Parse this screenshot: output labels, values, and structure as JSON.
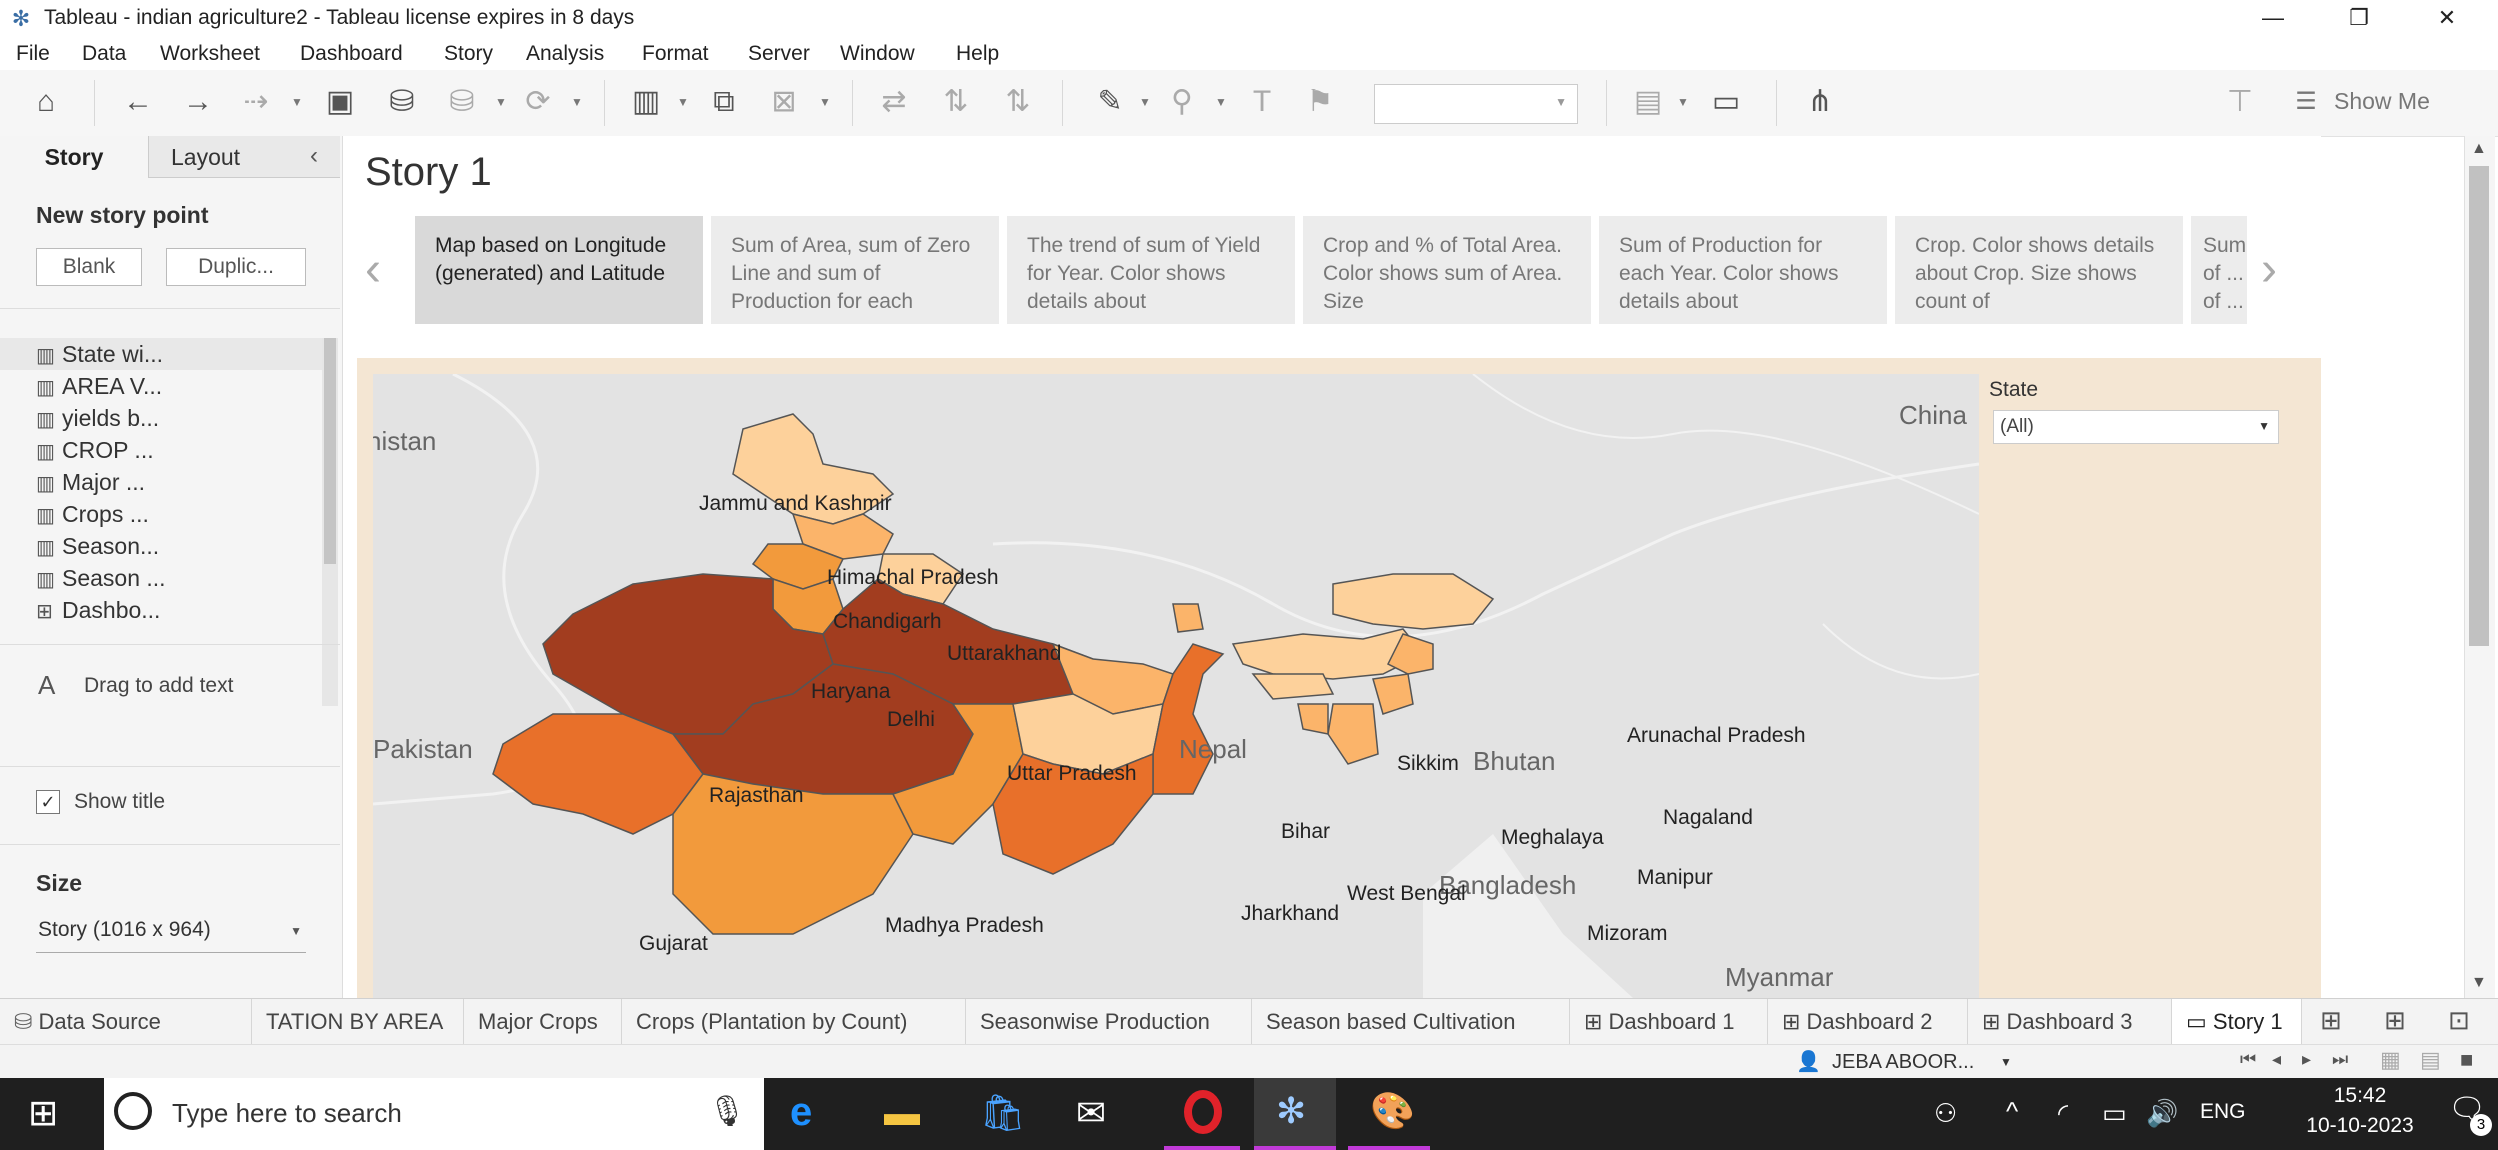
{
  "window": {
    "title": "Tableau - indian agriculture2 - Tableau license expires in 8 days",
    "minimize_icon": "minimize-icon",
    "restore_icon": "restore-icon",
    "close_icon": "close-icon"
  },
  "menu": [
    "File",
    "Data",
    "Worksheet",
    "Dashboard",
    "Story",
    "Analysis",
    "Format",
    "Server",
    "Window",
    "Help"
  ],
  "toolbar": {
    "show_me_label": "Show Me"
  },
  "left_panel": {
    "tabs": [
      "Story",
      "Layout"
    ],
    "new_story_point_heading": "New story point",
    "blank_button": "Blank",
    "duplicate_button": "Duplic...",
    "sheets": [
      {
        "label": "State wi...",
        "icon": "worksheet-icon"
      },
      {
        "label": "AREA V...",
        "icon": "worksheet-icon"
      },
      {
        "label": "yields b...",
        "icon": "worksheet-icon"
      },
      {
        "label": "CROP ...",
        "icon": "worksheet-icon"
      },
      {
        "label": "Major ...",
        "icon": "worksheet-icon"
      },
      {
        "label": "Crops ...",
        "icon": "worksheet-icon"
      },
      {
        "label": "Season...",
        "icon": "worksheet-icon"
      },
      {
        "label": "Season ...",
        "icon": "worksheet-icon"
      },
      {
        "label": "Dashbo...",
        "icon": "dashboard-icon"
      }
    ],
    "drag_text": "Drag to add text",
    "show_title_label": "Show title",
    "show_title_checked": true,
    "size_heading": "Size",
    "size_value": "Story (1016 x 964)"
  },
  "story": {
    "title": "Story 1",
    "points": [
      "Map based on Longitude (generated) and Latitude",
      "Sum of Area, sum of Zero Line and sum of Production for each",
      "The trend of sum of Yield for Year.  Color shows details about",
      "Crop and % of Total Area.  Color shows sum of Area.  Size",
      "Sum of Production for each Year.  Color shows details about",
      "Crop.  Color shows details about Crop. Size shows count of",
      "Sum of ... of ..."
    ],
    "active_point": 0
  },
  "map": {
    "countries": [
      "China",
      "Pakistan",
      "Nepal",
      "Bhutan",
      "Bangladesh",
      "Myanmar",
      "nistan"
    ],
    "states": [
      "Jammu and Kashmir",
      "Himachal Pradesh",
      "Chandigarh",
      "Uttarakhand",
      "Haryana",
      "Delhi",
      "Rajasthan",
      "Uttar Pradesh",
      "Sikkim",
      "Arunachal Pradesh",
      "Bihar",
      "Meghalaya",
      "Nagaland",
      "West Bengal",
      "Manipur",
      "Jharkhand",
      "Mizoram",
      "Madhya Pradesh",
      "Gujarat"
    ],
    "colors": {
      "lightest": "#fdd19b",
      "light": "#fbb46a",
      "medium": "#f29a3c",
      "orange": "#e8702a",
      "dark": "#a23d1f"
    }
  },
  "filter": {
    "label": "State",
    "value": "(All)"
  },
  "tabs": [
    "Data Source",
    "TATION BY AREA",
    "Major Crops",
    "Crops (Plantation by Count)",
    "Seasonwise Production",
    "Season based Cultivation",
    "Dashboard 1",
    "Dashboard 2",
    "Dashboard 3",
    "Story 1"
  ],
  "active_tab": "Story 1",
  "statusbar": {
    "user": "JEBA ABOOR..."
  },
  "taskbar": {
    "search_placeholder": "Type here to search",
    "language": "ENG",
    "time": "15:42",
    "date": "10-10-2023",
    "notification_count": "3"
  }
}
